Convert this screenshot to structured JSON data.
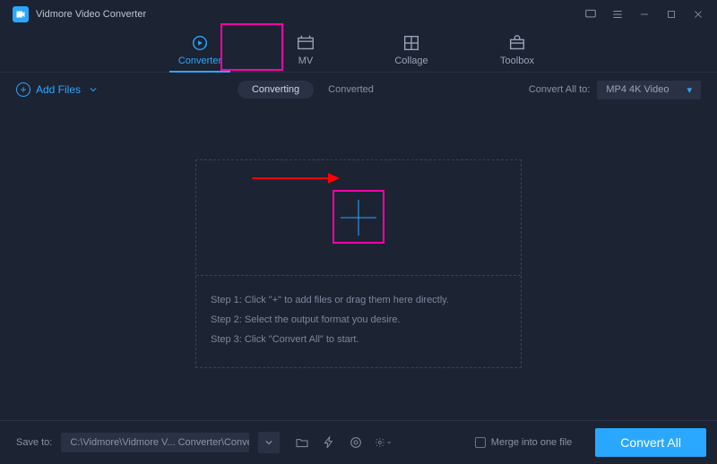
{
  "titlebar": {
    "app_name": "Vidmore Video Converter"
  },
  "nav": {
    "items": [
      {
        "label": "Converter",
        "active": true
      },
      {
        "label": "MV"
      },
      {
        "label": "Collage"
      },
      {
        "label": "Toolbox"
      }
    ]
  },
  "toolbar": {
    "add_files": "Add Files",
    "segment": {
      "converting": "Converting",
      "converted": "Converted",
      "active": "converting"
    },
    "convert_all_to_label": "Convert All to:",
    "format": "MP4 4K Video"
  },
  "drop": {
    "step1": "Step 1: Click \"+\" to add files or drag them here directly.",
    "step2": "Step 2: Select the output format you desire.",
    "step3": "Step 3: Click \"Convert All\" to start."
  },
  "bottom": {
    "save_to_label": "Save to:",
    "path": "C:\\Vidmore\\Vidmore V... Converter\\Converted",
    "merge_label": "Merge into one file",
    "convert_all": "Convert All"
  },
  "colors": {
    "accent": "#2aa8ff",
    "annotation": "#ff00a8",
    "arrow": "#ff0000"
  }
}
